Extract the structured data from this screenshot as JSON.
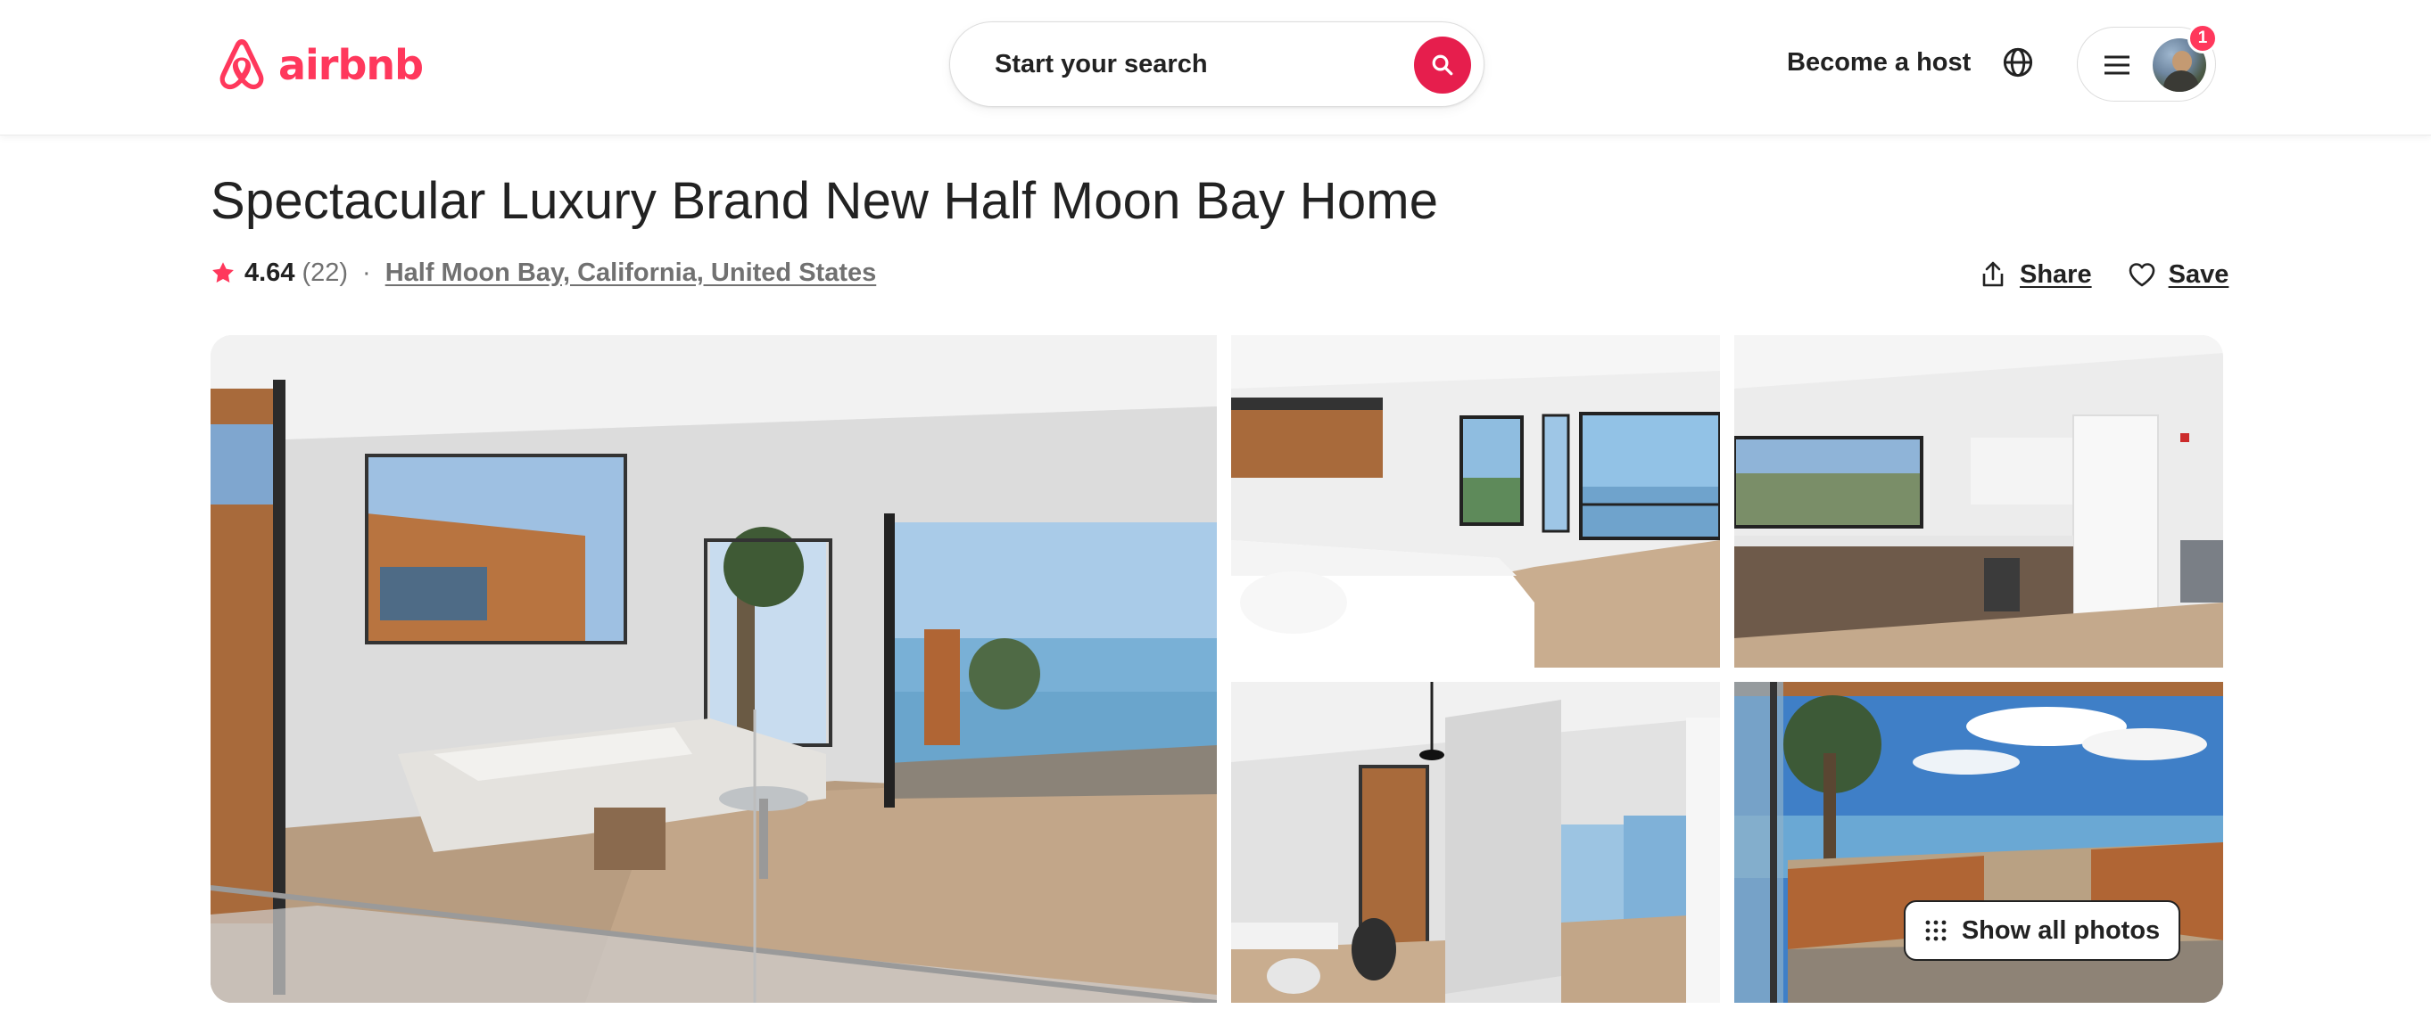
{
  "header": {
    "brand_name": "airbnb",
    "search_placeholder": "Start your search",
    "host_link": "Become a host",
    "notification_count": "1"
  },
  "listing": {
    "title": "Spectacular Luxury Brand New Half Moon Bay Home",
    "rating": "4.64",
    "reviews": "(22)",
    "separator": "·",
    "location": "Half Moon Bay, California, United States",
    "share_label": "Share",
    "save_label": "Save"
  },
  "gallery": {
    "show_all_label": "Show all photos",
    "photos": [
      "living-room-view",
      "bedroom",
      "kitchen",
      "hallway-stairs",
      "deck-ocean-view"
    ]
  },
  "colors": {
    "brand": "#FF385C",
    "search_button": "#E61E4D",
    "text": "#222222",
    "muted": "#717171"
  }
}
